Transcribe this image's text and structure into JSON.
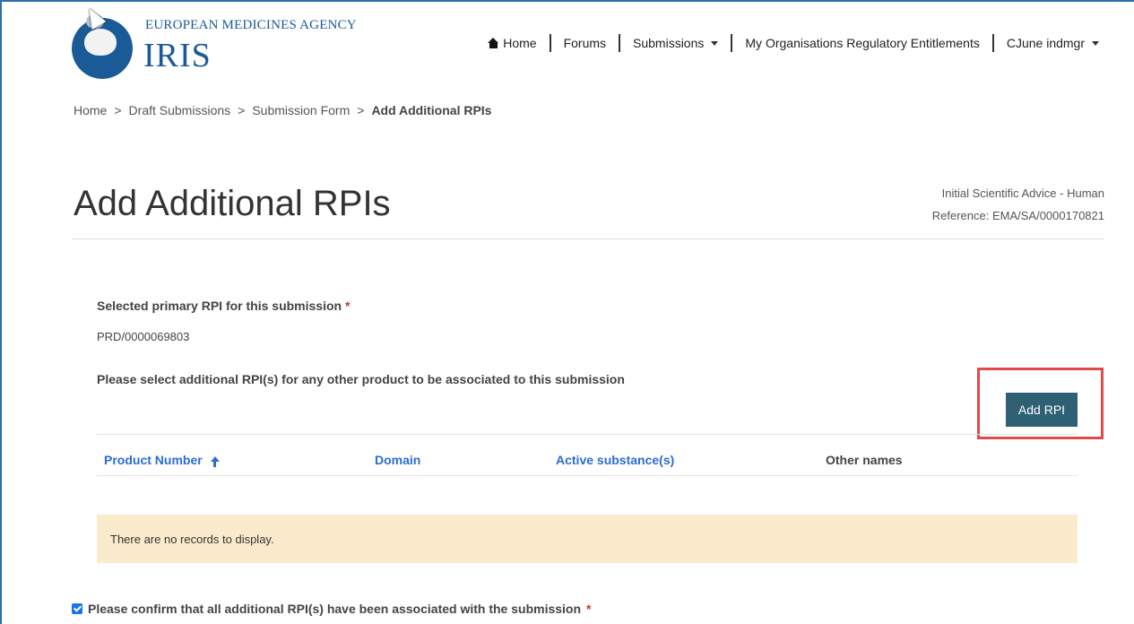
{
  "brand": {
    "agency_name": "EUROPEAN MEDICINES AGENCY",
    "product_name": "IRIS",
    "primary_color": "#1a5a96"
  },
  "nav": {
    "home": "Home",
    "forums": "Forums",
    "submissions": "Submissions",
    "entitlements": "My Organisations Regulatory Entitlements",
    "user": "CJune indmgr"
  },
  "breadcrumb": {
    "items": [
      "Home",
      "Draft Submissions",
      "Submission Form"
    ],
    "separator": ">",
    "current": "Add Additional RPIs"
  },
  "page": {
    "title": "Add Additional RPIs",
    "procedure": "Initial Scientific Advice - Human",
    "reference": "Reference: EMA/SA/0000170821"
  },
  "form": {
    "primary_label": "Selected primary RPI for this submission",
    "required_mark": "*",
    "primary_value": "PRD/0000069803",
    "select_label": "Please select additional RPI(s) for any other product to be associated to this submission",
    "add_button": "Add RPI",
    "button_color": "#2f6074"
  },
  "table": {
    "columns": [
      "Product Number",
      "Domain",
      "Active substance(s)",
      "Other names"
    ],
    "sort_column": "Product Number",
    "sort_direction": "ascending",
    "empty_message": "There are no records to display."
  },
  "confirm": {
    "label": "Please confirm that all additional RPI(s) have been associated with the submission",
    "checked": true
  }
}
